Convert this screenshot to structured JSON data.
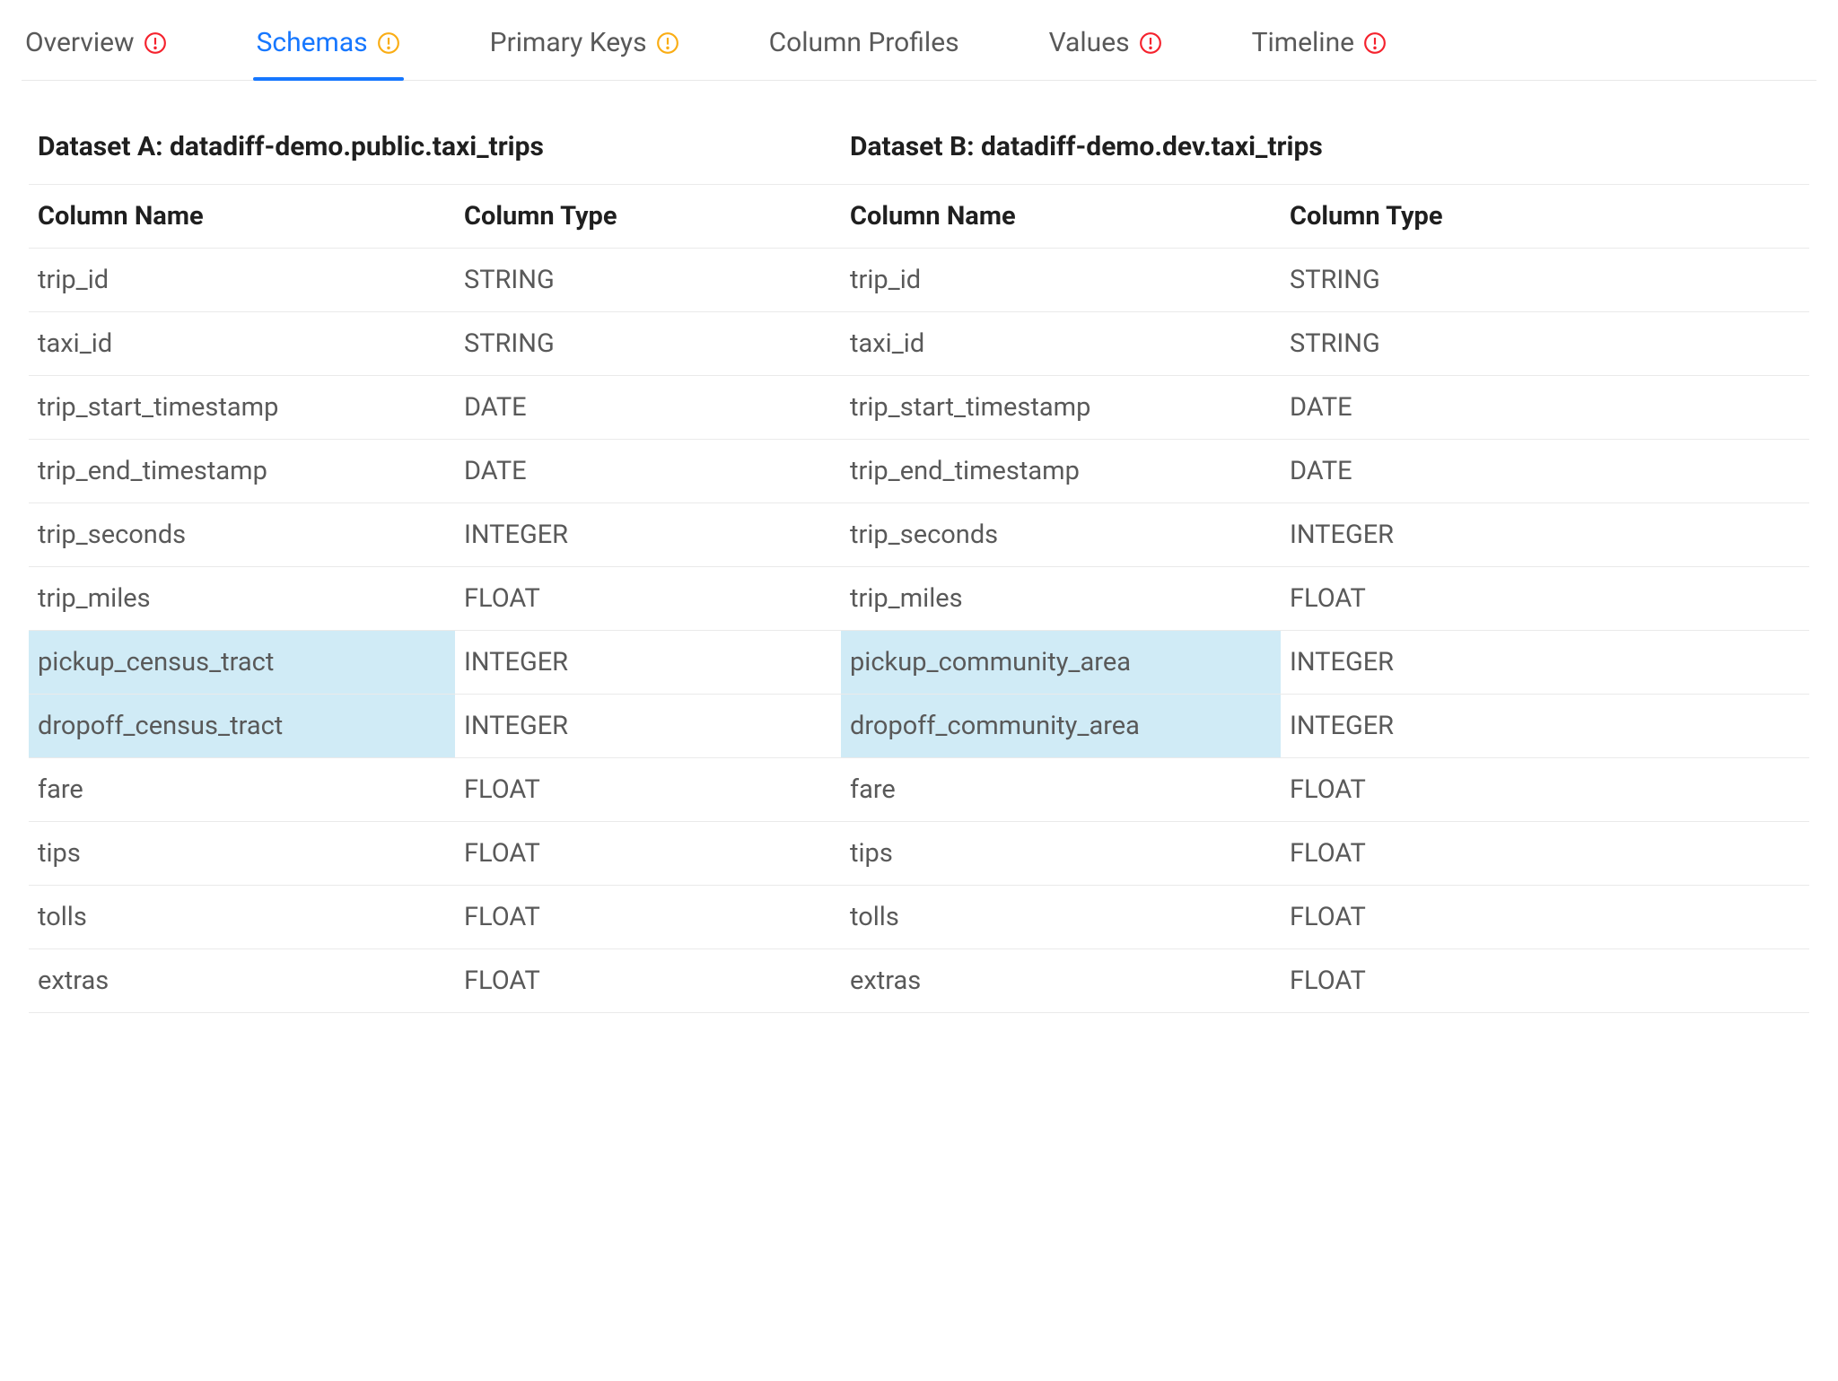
{
  "colors": {
    "accent": "#1677ff",
    "warning": "#faad14",
    "error": "#f5222d",
    "highlight": "#d0ebf6"
  },
  "tabs": [
    {
      "label": "Overview",
      "status": "error"
    },
    {
      "label": "Schemas",
      "status": "warning",
      "active": true
    },
    {
      "label": "Primary Keys",
      "status": "warning"
    },
    {
      "label": "Column Profiles",
      "status": "none"
    },
    {
      "label": "Values",
      "status": "error"
    },
    {
      "label": "Timeline",
      "status": "error"
    }
  ],
  "datasets": {
    "a": {
      "title": "Dataset A: datadiff-demo.public.taxi_trips"
    },
    "b": {
      "title": "Dataset B: datadiff-demo.dev.taxi_trips"
    }
  },
  "columns_header": {
    "name": "Column Name",
    "type": "Column Type"
  },
  "rows": [
    {
      "a_name": "trip_id",
      "a_type": "STRING",
      "b_name": "trip_id",
      "b_type": "STRING"
    },
    {
      "a_name": "taxi_id",
      "a_type": "STRING",
      "b_name": "taxi_id",
      "b_type": "STRING"
    },
    {
      "a_name": "trip_start_timestamp",
      "a_type": "DATE",
      "b_name": "trip_start_timestamp",
      "b_type": "DATE"
    },
    {
      "a_name": "trip_end_timestamp",
      "a_type": "DATE",
      "b_name": "trip_end_timestamp",
      "b_type": "DATE"
    },
    {
      "a_name": "trip_seconds",
      "a_type": "INTEGER",
      "b_name": "trip_seconds",
      "b_type": "INTEGER"
    },
    {
      "a_name": "trip_miles",
      "a_type": "FLOAT",
      "b_name": "trip_miles",
      "b_type": "FLOAT"
    },
    {
      "a_name": "pickup_census_tract",
      "a_type": "INTEGER",
      "b_name": "pickup_community_area",
      "b_type": "INTEGER",
      "a_diff": true,
      "b_diff": true
    },
    {
      "a_name": "dropoff_census_tract",
      "a_type": "INTEGER",
      "b_name": "dropoff_community_area",
      "b_type": "INTEGER",
      "a_diff": true,
      "b_diff": true
    },
    {
      "a_name": "fare",
      "a_type": "FLOAT",
      "b_name": "fare",
      "b_type": "FLOAT"
    },
    {
      "a_name": "tips",
      "a_type": "FLOAT",
      "b_name": "tips",
      "b_type": "FLOAT"
    },
    {
      "a_name": "tolls",
      "a_type": "FLOAT",
      "b_name": "tolls",
      "b_type": "FLOAT"
    },
    {
      "a_name": "extras",
      "a_type": "FLOAT",
      "b_name": "extras",
      "b_type": "FLOAT"
    }
  ]
}
